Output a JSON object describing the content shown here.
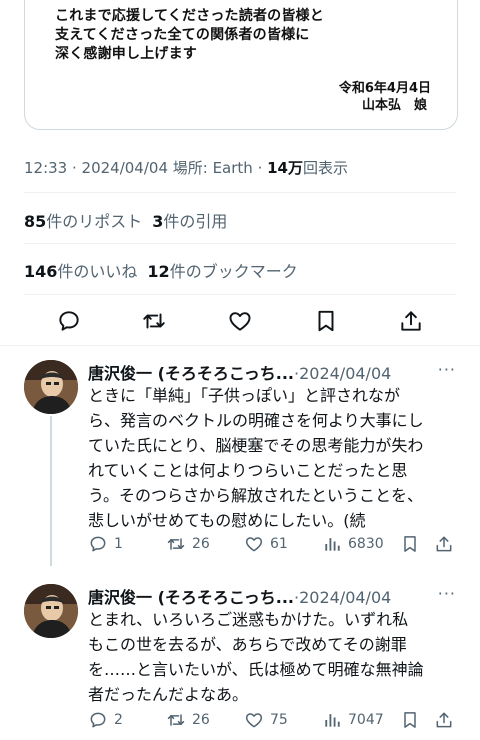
{
  "embedded_card": {
    "lines": [
      "これまで応援してくださった読者の皆様と",
      "支えてくださった全ての関係者の皆様に",
      "深く感謝申し上げます"
    ],
    "date": "令和6年4月4日",
    "signature": "山本弘　娘"
  },
  "post_meta": {
    "time_date_place": "12:33 · 2024/04/04 場所: Earth · ",
    "views_count": "14万",
    "views_label": "回表示"
  },
  "stats": {
    "reposts_count": "85",
    "reposts_label": "件のリポスト",
    "quotes_count": "3",
    "quotes_label": "件の引用",
    "likes_count": "146",
    "likes_label": "件のいいね",
    "bookmarks_count": "12",
    "bookmarks_label": "件のブックマーク"
  },
  "icons": {
    "reply": "reply-icon",
    "repost": "repost-icon",
    "like": "heart-icon",
    "bookmark": "bookmark-icon",
    "share": "share-icon",
    "views": "views-icon"
  },
  "replies": [
    {
      "name": "唐沢俊一 (そろそろこっち...",
      "date": "·2024/04/04",
      "more": "···",
      "lines": [
        "ときに「単純」「子供っぽい」と評されなが",
        "ら、発言のベクトルの明確さを何より大事にし",
        "ていた氏にとり、脳梗塞でその思考能力が失わ",
        "れていくことは何よりつらいことだったと思",
        "う。そのつらさから解放されたということを、",
        "悲しいがせめてもの慰めにしたい。(続"
      ],
      "reply_count": "1",
      "repost_count": "26",
      "like_count": "61",
      "view_count": "6830"
    },
    {
      "name": "唐沢俊一 (そろそろこっち...",
      "date": "·2024/04/04",
      "more": "···",
      "lines": [
        "とまれ、いろいろご迷惑もかけた。いずれ私",
        "もこの世を去るが、あちらで改めてその謝罪",
        "を……と言いたいが、氏は極めて明確な無神論",
        "者だったんだよなあ。"
      ],
      "reply_count": "2",
      "repost_count": "26",
      "like_count": "75",
      "view_count": "7047"
    }
  ]
}
